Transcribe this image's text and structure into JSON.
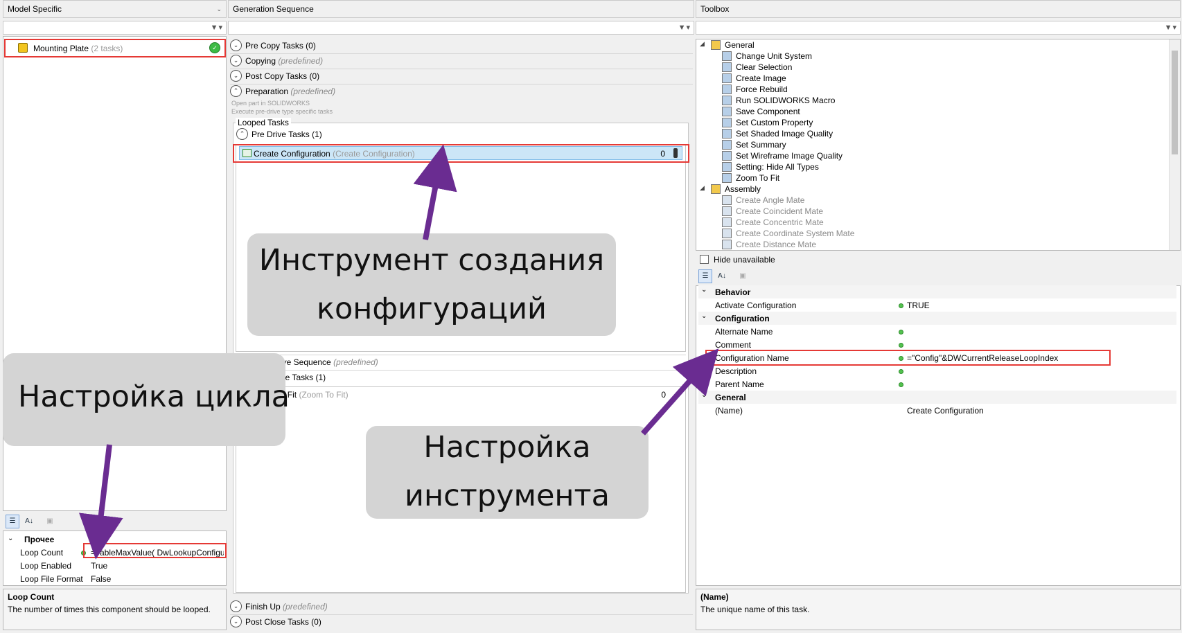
{
  "left_panel": {
    "header": "Model Specific",
    "item": {
      "name": "Mounting Plate",
      "count": "(2 tasks)"
    },
    "props": {
      "category": "Прочее",
      "rows": [
        {
          "name": "Loop Count",
          "value": "=TableMaxValue( DwLookupConfigura"
        },
        {
          "name": "Loop Enabled",
          "value": "True"
        },
        {
          "name": "Loop File Format",
          "value": "False"
        }
      ]
    },
    "desc": {
      "title": "Loop Count",
      "text": "The number of times this component should be looped."
    }
  },
  "middle_panel": {
    "header": "Generation Sequence",
    "groups": {
      "pre_copy": "Pre Copy Tasks (0)",
      "copying": "Copying",
      "copying_note": "(predefined)",
      "post_copy": "Post Copy Tasks (0)",
      "preparation": "Preparation",
      "preparation_note": "(predefined)",
      "prep_line1": "Open part in SOLIDWORKS",
      "prep_line2": "Execute pre-drive type specific tasks",
      "looped_tasks": "Looped Tasks",
      "pre_drive": "Pre Drive Tasks (1)",
      "main_drive": "Main Drive Sequence",
      "main_drive_note": "(predefined)",
      "post_drive": "Post Drive Tasks (1)",
      "finish_up": "Finish Up",
      "finish_up_note": "(predefined)",
      "post_close": "Post Close Tasks (0)"
    },
    "tasks": {
      "create_config": {
        "name": "Create Configuration",
        "sub": "(Create Configuration)",
        "count": "0"
      },
      "zoom_to_fit": {
        "name": "Zoom To Fit",
        "sub": "(Zoom To Fit)",
        "count": "0"
      }
    }
  },
  "toolbox": {
    "header": "Toolbox",
    "general_label": "General",
    "general_items": [
      "Change Unit System",
      "Clear Selection",
      "Create Image",
      "Force Rebuild",
      "Run SOLIDWORKS Macro",
      "Save Component",
      "Set Custom Property",
      "Set Shaded Image Quality",
      "Set Summary",
      "Set Wireframe Image Quality",
      "Setting: Hide All Types",
      "Zoom To Fit"
    ],
    "assembly_label": "Assembly",
    "assembly_items": [
      "Create Angle Mate",
      "Create Coincident Mate",
      "Create Concentric Mate",
      "Create Coordinate System Mate",
      "Create Distance Mate"
    ],
    "hide_unavailable": "Hide unavailable"
  },
  "props_right": {
    "cat_behavior": "Behavior",
    "activate_config": {
      "name": "Activate Configuration",
      "value": "TRUE"
    },
    "cat_configuration": "Configuration",
    "alternate_name": "Alternate Name",
    "comment": "Comment",
    "config_name": {
      "name": "Configuration Name",
      "value": "=\"Config\"&DWCurrentReleaseLoopIndex"
    },
    "description": "Description",
    "parent_name": "Parent Name",
    "cat_general": "General",
    "name_row": {
      "name": "(Name)",
      "value": "Create Configuration"
    },
    "desc": {
      "title": "(Name)",
      "text": "The unique name of this task."
    }
  },
  "callouts": {
    "tool_create": [
      "Инструмент создания",
      "конфигураций"
    ],
    "loop_setup": "Настройка цикла",
    "tool_setup": [
      "Настройка",
      "инструмента"
    ]
  },
  "colors": {
    "highlight_red": "#e53935",
    "arrow_purple": "#6a2c91",
    "callout_bg": "#d4d4d4",
    "selected_row": "#cce6f7"
  }
}
